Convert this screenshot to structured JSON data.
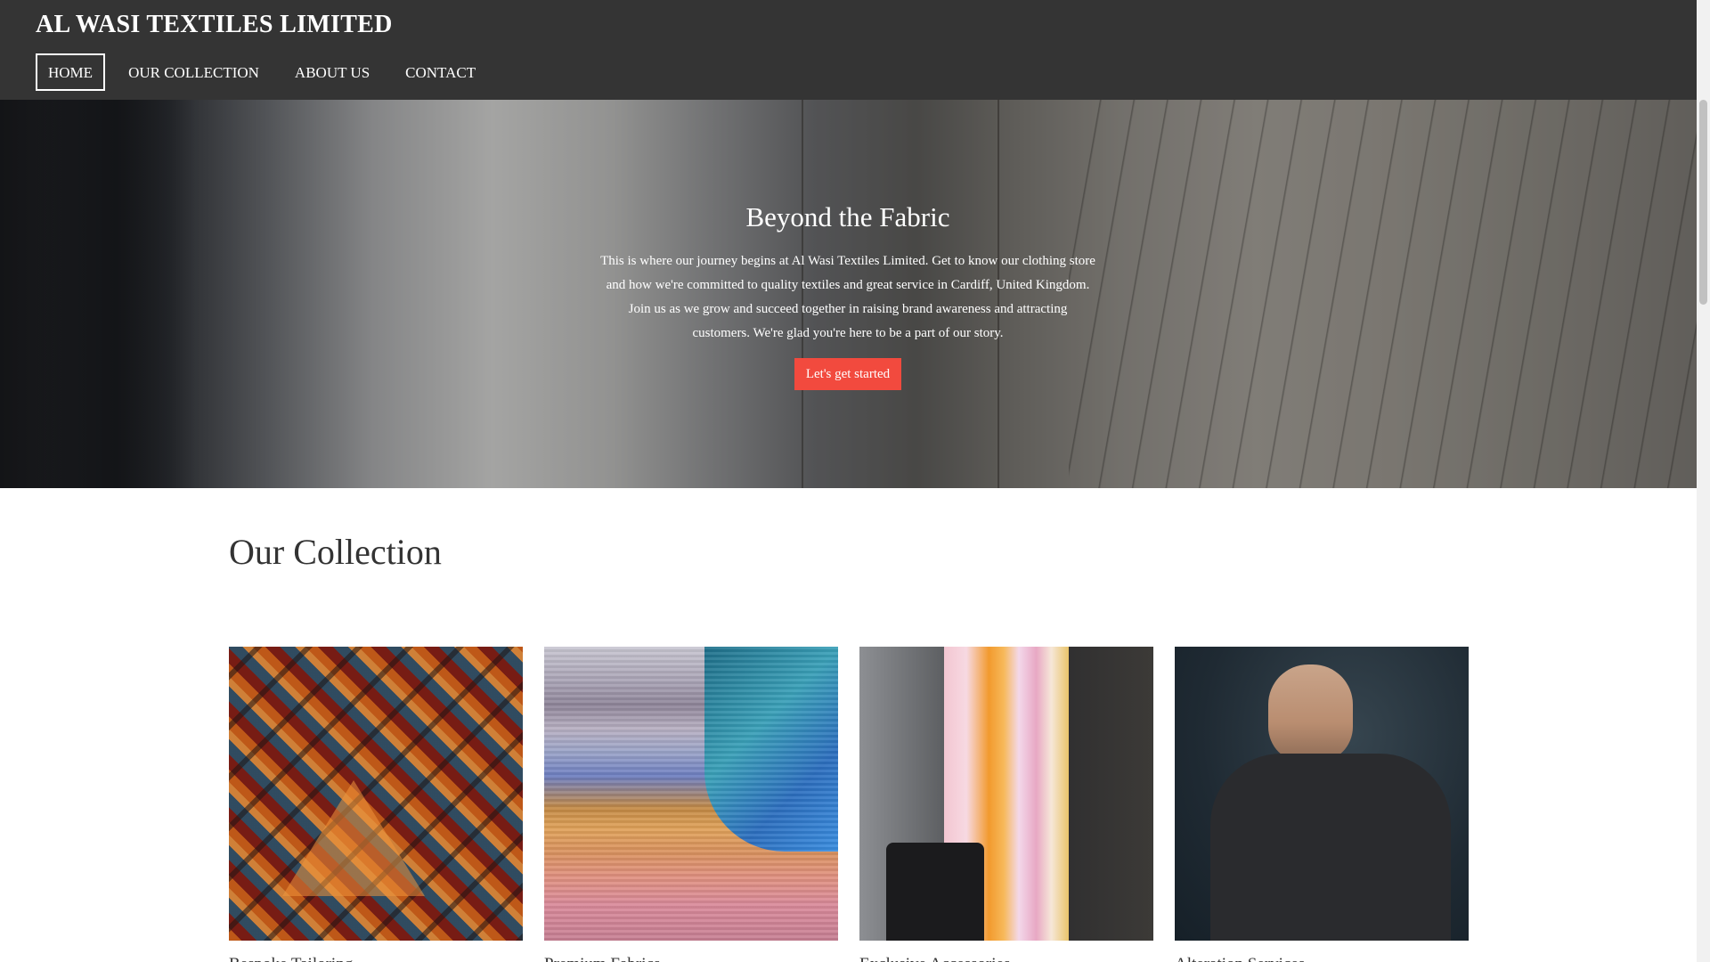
{
  "header": {
    "brand": "AL WASI TEXTILES LIMITED",
    "nav": [
      {
        "label": "HOME",
        "active": true
      },
      {
        "label": "OUR COLLECTION",
        "active": false
      },
      {
        "label": "ABOUT US",
        "active": false
      },
      {
        "label": "CONTACT",
        "active": false
      }
    ]
  },
  "hero": {
    "title": "Beyond the Fabric",
    "text": "This is where our journey begins at Al Wasi Textiles Limited. Get to know our clothing store and how we're committed to quality textiles and great service in Cardiff, United Kingdom. Join us as we grow and succeed together in raising brand awareness and attracting customers. We're glad you're here to be a part of our story.",
    "button_label": "Let's get started"
  },
  "collection": {
    "title": "Our Collection",
    "items": [
      {
        "caption": "Bespoke Tailoring"
      },
      {
        "caption": "Premium Fabrics"
      },
      {
        "caption": "Exclusive Accessories"
      },
      {
        "caption": "Alteration Services"
      }
    ]
  },
  "colors": {
    "header_bg": "#343434",
    "accent": "#f24a3e",
    "text_dark": "#333333"
  }
}
